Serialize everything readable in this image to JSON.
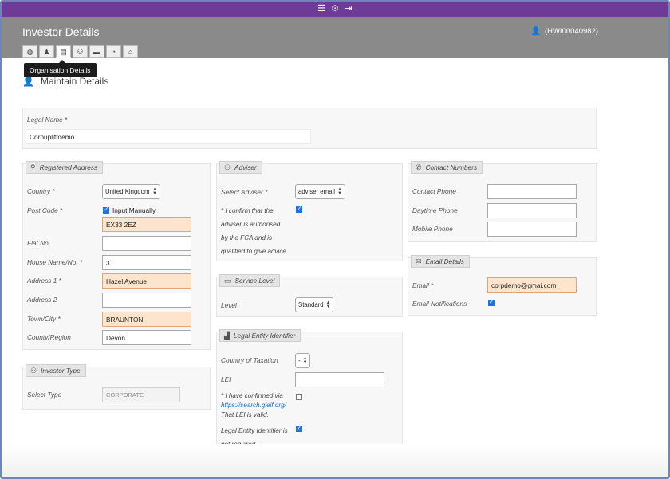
{
  "topbar": {
    "icons": [
      "menu-icon",
      "gear-icon",
      "logout-icon"
    ]
  },
  "header": {
    "title": "Investor Details",
    "user_id": "(HWI00040982)"
  },
  "tabs": [
    "globe-icon",
    "person-icon",
    "organisation-icon",
    "people-icon",
    "folder-icon",
    "pie-chart-icon",
    "bank-icon"
  ],
  "tooltip": "Organisation Details",
  "maintain": {
    "title": "Maintain Details"
  },
  "legal_name": {
    "label": "Legal Name *",
    "value": "Corpupliftdemo"
  },
  "registered_address": {
    "title": "Registered Address",
    "country_label": "Country *",
    "country_value": "United Kingdom",
    "postcode_label": "Post Code *",
    "input_manually": "Input Manually",
    "postcode_value": "EX33 2EZ",
    "flat_label": "Flat No.",
    "flat_value": "",
    "house_label": "House Name/No. *",
    "house_value": "3",
    "address1_label": "Address 1 *",
    "address1_value": "Hazel Avenue",
    "address2_label": "Address 2",
    "address2_value": "",
    "town_label": "Town/City *",
    "town_value": "BRAUNTON",
    "county_label": "County/Region",
    "county_value": "Devon"
  },
  "investor_type": {
    "title": "Investor Type",
    "select_label": "Select Type",
    "select_value": "CORPORATE"
  },
  "adviser": {
    "title": "Adviser",
    "select_label": "Select Adviser *",
    "select_value": "adviser email",
    "confirm_line1": "* I confirm that the",
    "confirm_line2": "adviser is authorised",
    "confirm_line3": "by the FCA and is",
    "confirm_line4": "qualified to give advice"
  },
  "service_level": {
    "title": "Service Level",
    "level_label": "Level",
    "level_value": "Standard"
  },
  "lei": {
    "title": "Legal Entity Identifier",
    "country_label": "Country of Taxation",
    "country_value": "-",
    "lei_label": "LEI",
    "lei_value": "",
    "confirm_line1": "* I have confirmed via",
    "confirm_link": "https://search.gleif.org/",
    "confirm_line3": "That LEI is valid.",
    "notreq_line1": "Legal Entity Identifier is",
    "notreq_line2": "not required"
  },
  "contact": {
    "title": "Contact Numbers",
    "contact_label": "Contact Phone",
    "daytime_label": "Daytime Phone",
    "mobile_label": "Mobile Phone"
  },
  "email": {
    "title": "Email Details",
    "email_label": "Email *",
    "email_value": "corpdemo@gmai.com",
    "notif_label": "Email Notifications"
  },
  "colors": {
    "topbar": "#6e3c98",
    "header": "#8a8a8a",
    "highlight": "#fce5cc",
    "checkbox": "#1a73e8"
  }
}
